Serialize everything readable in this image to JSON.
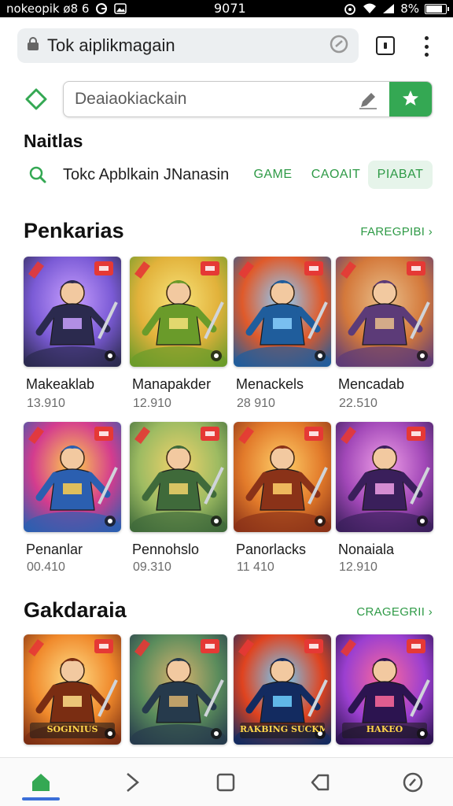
{
  "status_bar": {
    "left_text": "nokeopik ø8 6",
    "time": "9071",
    "battery_text": "8%",
    "battery_level": 0.82,
    "icons": [
      "google-icon",
      "image-icon",
      "alarm-icon",
      "wifi-icon",
      "signal-icon",
      "battery-icon"
    ]
  },
  "browser": {
    "url": "Tok aiplikmagain",
    "icons": [
      "lock-icon",
      "reload-icon",
      "tabs-icon",
      "menu-icon"
    ]
  },
  "search": {
    "placeholder": "Deaiaokiackain",
    "icons": [
      "store-logo-icon",
      "edit-icon",
      "star-icon"
    ]
  },
  "filters": {
    "title": "Naitlas",
    "query": "Tokc Apblkain JNanasin",
    "chips": [
      {
        "label": "GAME",
        "active": false
      },
      {
        "label": "CAOAIT",
        "active": false
      },
      {
        "label": "PIABAT",
        "active": true
      }
    ]
  },
  "sections": [
    {
      "title": "Penkarias",
      "link": "FAREGPIBI ›",
      "apps": [
        {
          "title": "Makeaklab",
          "meta": "13.910",
          "badge": "#e53935"
        },
        {
          "title": "Manapakder",
          "meta": "12.910",
          "badge": "#e53935"
        },
        {
          "title": "Menackels",
          "meta": "28 910",
          "badge": "#e53935"
        },
        {
          "title": "Mencadab",
          "meta": "22.510",
          "badge": "#e53935"
        },
        {
          "title": "Penanlar",
          "meta": "00.410",
          "badge": "#e53935"
        },
        {
          "title": "Pennohslo",
          "meta": "09.310",
          "badge": "#e53935"
        },
        {
          "title": "Panorlacks",
          "meta": "11 410",
          "badge": "#e53935"
        },
        {
          "title": "Nonaiala",
          "meta": "12.910",
          "badge": "#e53935"
        }
      ]
    },
    {
      "title": "Gakdaraia",
      "link": "CRAGEGRII ›",
      "apps": [
        {
          "art_text": "SOGINIUS"
        },
        {
          "art_text": ""
        },
        {
          "art_text": "RAKBING SUCKMATTE"
        },
        {
          "art_text": "HAKEO"
        }
      ]
    }
  ],
  "bottom_nav": {
    "items": [
      "home-icon",
      "forward-icon",
      "square-icon",
      "back-icon",
      "compass-icon"
    ],
    "accent": "#34a853"
  },
  "colors": {
    "accent_green": "#34a853",
    "link_green": "#2e9a46",
    "chip_bg": "#e6f4ea"
  }
}
